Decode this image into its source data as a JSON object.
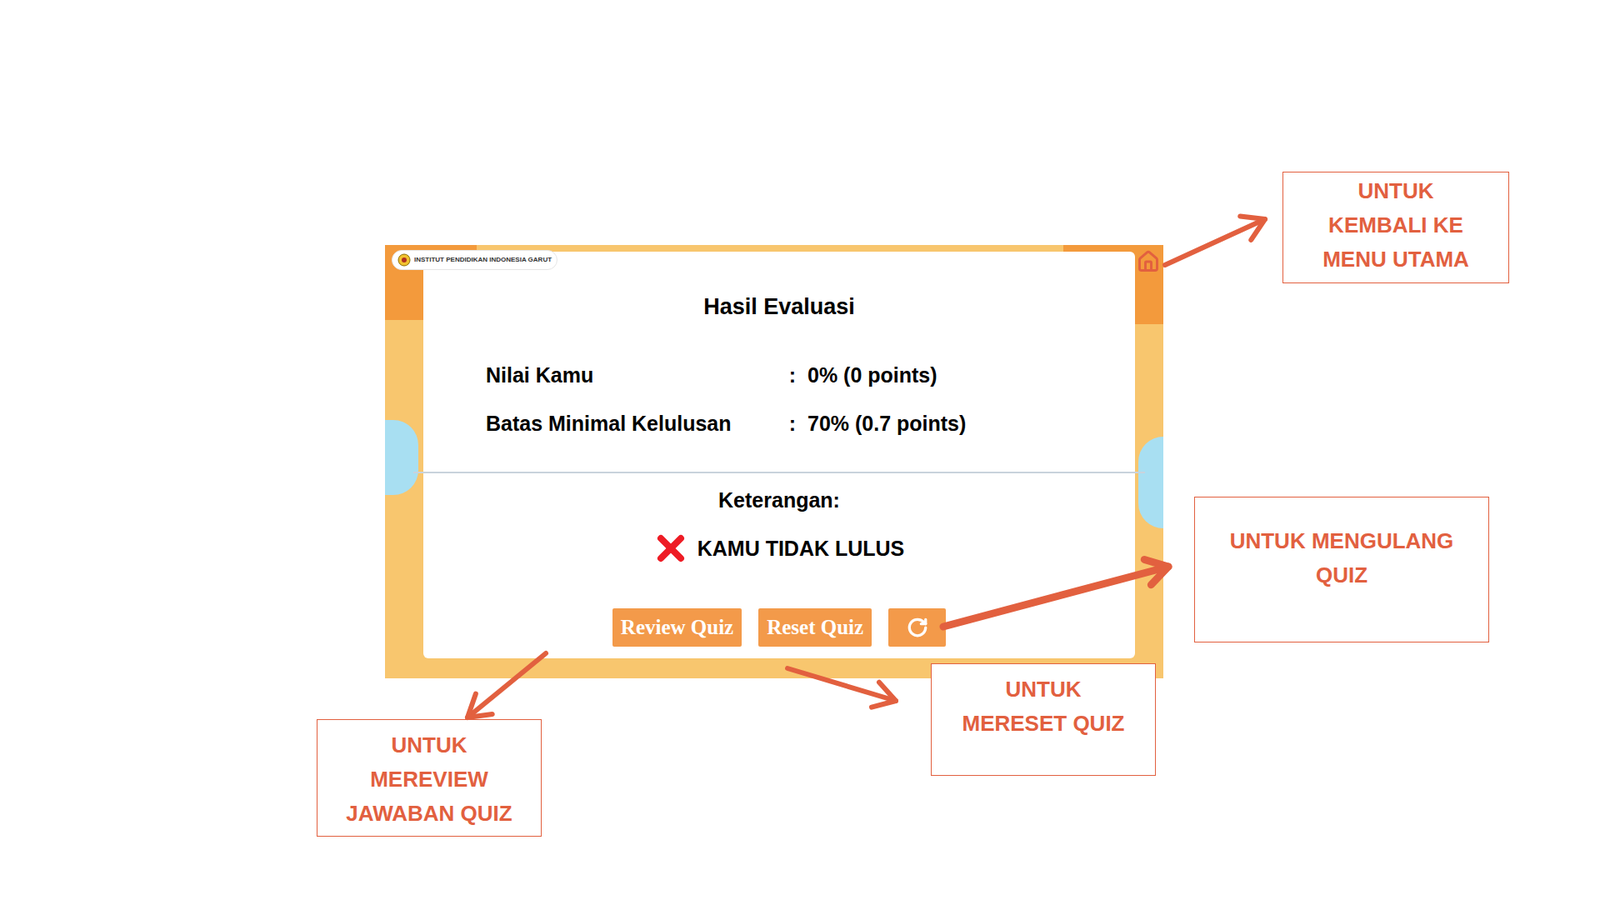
{
  "card": {
    "logo_text": "INSTITUT PENDIDIKAN INDONESIA GARUT",
    "title": "Hasil Evaluasi",
    "rows": [
      {
        "label": "Nilai Kamu",
        "separator": ":",
        "value": "0% (0 points)"
      },
      {
        "label": "Batas Minimal Kelulusan",
        "separator": ":",
        "value": "70% (0.7 points)"
      }
    ],
    "result_heading": "Keterangan:",
    "result": "KAMU TIDAK LULUS",
    "passed": false,
    "buttons": [
      {
        "label": "Review Quiz"
      },
      {
        "label": "Reset Quiz"
      }
    ]
  },
  "annotations": [
    {
      "lines": [
        "UNTUK",
        "KEMBALI KE",
        "MENU UTAMA"
      ]
    },
    {
      "lines": [
        "UNTUK MENGULANG",
        "QUIZ"
      ]
    },
    {
      "lines": [
        "UNTUK",
        "MERESET QUIZ"
      ]
    },
    {
      "lines": [
        "UNTUK",
        "MEREVIEW",
        "JAWABAN QUIZ"
      ]
    }
  ]
}
